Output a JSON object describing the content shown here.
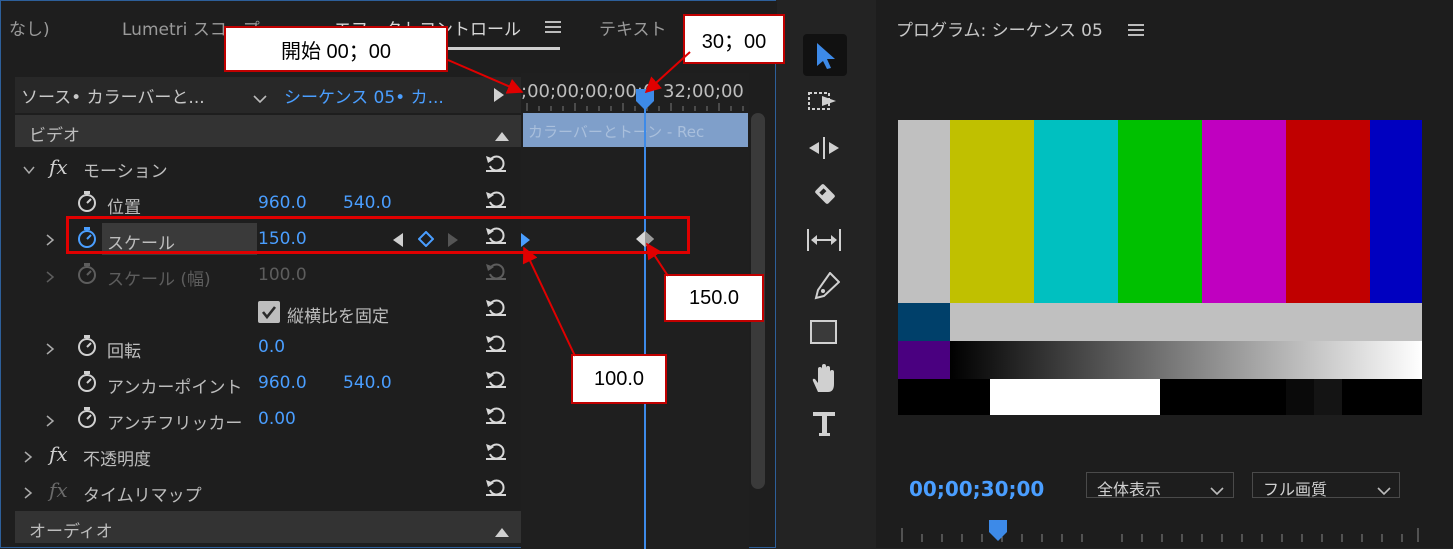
{
  "effect_controls": {
    "tabs": [
      {
        "label": "なし)"
      },
      {
        "label": "Lumetri スコープ"
      },
      {
        "label": "エフェクトコントロール"
      },
      {
        "label": "テキスト"
      }
    ],
    "menu_icon": "hamburger-icon",
    "source_label": "ソース• カラーバーと...",
    "sequence_label": "シーケンス 05• カ...",
    "ruler_timecode": ";00;00;00;00;0",
    "ruler_timecode_right": "32;00;00",
    "clip_name": "カラーバーとトーン - Rec",
    "sections": {
      "video": "ビデオ",
      "audio": "オーディオ"
    },
    "motion": {
      "fx": "fx",
      "label": "モーション"
    },
    "properties": {
      "position": {
        "label": "位置",
        "x": "960.0",
        "y": "540.0"
      },
      "scale": {
        "label": "スケール",
        "value": "150.0"
      },
      "scale_width": {
        "label": "スケール (幅)",
        "value": "100.0"
      },
      "uniform_scale": {
        "label": "縦横比を固定",
        "checked": true
      },
      "rotation": {
        "label": "回転",
        "value": "0.0"
      },
      "anchor": {
        "label": "アンカーポイント",
        "x": "960.0",
        "y": "540.0"
      },
      "flicker": {
        "label": "アンチフリッカー",
        "value": "0.00"
      }
    },
    "opacity": {
      "fx": "fx",
      "label": "不透明度"
    },
    "time_remap": {
      "fx": "fx",
      "label": "タイムリマップ"
    }
  },
  "program_monitor": {
    "title": "プログラム: シーケンス 05",
    "timecode": "00;00;30;00",
    "zoom": "全体表示",
    "quality": "フル画質"
  },
  "callouts": {
    "start": "開始 00；00",
    "end_time": "30；00",
    "value_end": "150.0",
    "value_start": "100.0"
  },
  "colors": {
    "accent_blue": "#4a9eff",
    "callout_red": "#e00000",
    "bars_top": [
      "#c0c0c0",
      "#c0c000",
      "#00c0c0",
      "#00c000",
      "#c000c0",
      "#c00000",
      "#0000c0"
    ]
  }
}
